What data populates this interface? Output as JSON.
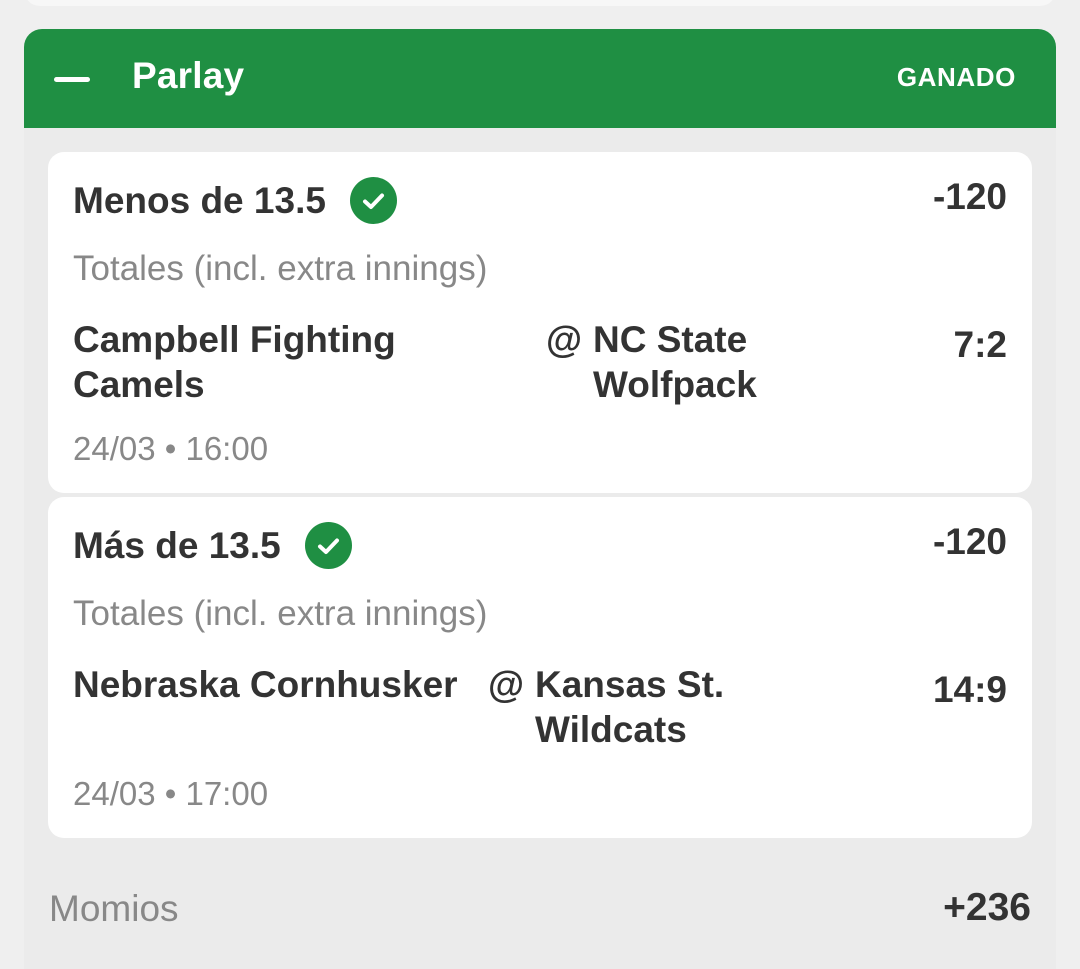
{
  "header": {
    "title": "Parlay",
    "status": "GANADO",
    "collapse_icon": "minus-icon",
    "color": "#1f8f43"
  },
  "selections": [
    {
      "pick": "Menos de 13.5",
      "status_icon": "check-circle-icon",
      "odds": "-120",
      "market": "Totales (incl. extra innings)",
      "home_team": "Campbell Fighting Camels",
      "away_prefix": "@",
      "away_team": "NC State Wolfpack",
      "score": "7:2",
      "datetime": "24/03 • 16:00"
    },
    {
      "pick": "Más de 13.5",
      "status_icon": "check-circle-icon",
      "odds": "-120",
      "market": "Totales (incl. extra innings)",
      "home_team": "Nebraska Cornhusker",
      "away_prefix": "@",
      "away_team": "Kansas St. Wildcats",
      "score": "14:9",
      "datetime": "24/03 • 17:00"
    }
  ],
  "summary": {
    "label": "Momios",
    "value": "+236"
  }
}
